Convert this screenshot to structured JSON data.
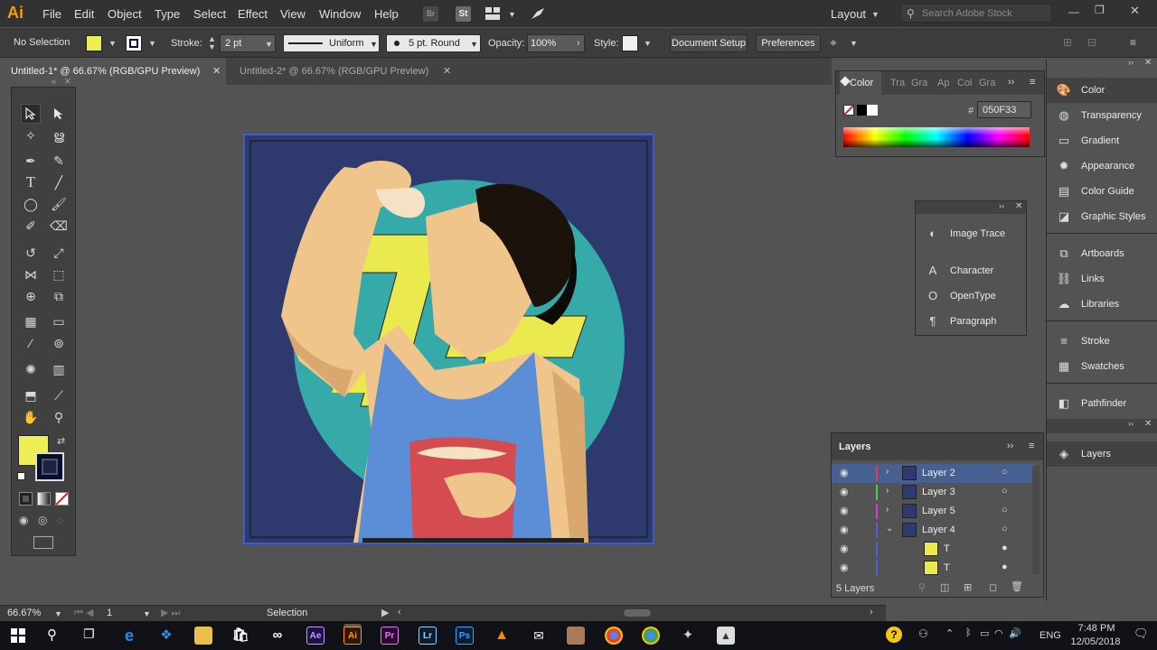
{
  "app": {
    "logo": "Ai"
  },
  "menu": [
    "File",
    "Edit",
    "Object",
    "Type",
    "Select",
    "Effect",
    "View",
    "Window",
    "Help"
  ],
  "menubar_icons": {
    "bridge": "Br",
    "stock": "St"
  },
  "workspace": {
    "label": "Layout"
  },
  "search": {
    "placeholder": "Search Adobe Stock"
  },
  "control": {
    "selection": "No Selection",
    "fill_color": "#eeee55",
    "stroke_label": "Stroke:",
    "stroke_value": "2 pt",
    "stroke_profile": "Uniform",
    "brush": "5 pt. Round",
    "opacity_label": "Opacity:",
    "opacity_value": "100%",
    "style_label": "Style:",
    "document_setup": "Document Setup",
    "preferences": "Preferences"
  },
  "tabs": [
    {
      "label": "Untitled-1* @ 66.67% (RGB/GPU Preview)",
      "active": true
    },
    {
      "label": "Untitled-2* @ 66.67% (RGB/GPU Preview)",
      "active": false
    }
  ],
  "color_panel": {
    "tabs": [
      "Color",
      "Tra",
      "Gra",
      "Ap",
      "Col",
      "Gra"
    ],
    "hash": "#",
    "hex_value": "050F33"
  },
  "float_panel": {
    "items": [
      {
        "icon": "image-trace-icon",
        "label": "Image Trace"
      },
      {
        "icon": "character-icon",
        "label": "Character"
      },
      {
        "icon": "opentype-icon",
        "label": "OpenType"
      },
      {
        "icon": "paragraph-icon",
        "label": "Paragraph"
      }
    ]
  },
  "right_dock": {
    "group1": [
      {
        "icon": "color-icon",
        "label": "Color"
      },
      {
        "icon": "transparency-icon",
        "label": "Transparency"
      },
      {
        "icon": "gradient-icon",
        "label": "Gradient"
      },
      {
        "icon": "appearance-icon",
        "label": "Appearance"
      },
      {
        "icon": "color-guide-icon",
        "label": "Color Guide"
      },
      {
        "icon": "graphic-styles-icon",
        "label": "Graphic Styles"
      }
    ],
    "group2": [
      {
        "icon": "artboards-icon",
        "label": "Artboards"
      },
      {
        "icon": "links-icon",
        "label": "Links"
      },
      {
        "icon": "libraries-icon",
        "label": "Libraries"
      }
    ],
    "group3": [
      {
        "icon": "stroke-icon",
        "label": "Stroke"
      },
      {
        "icon": "swatches-icon",
        "label": "Swatches"
      }
    ],
    "group4": [
      {
        "icon": "pathfinder-icon",
        "label": "Pathfinder"
      }
    ],
    "group5": [
      {
        "icon": "layers-icon",
        "label": "Layers"
      }
    ]
  },
  "layers_panel": {
    "title": "Layers",
    "rows": [
      {
        "name": "Layer 2",
        "color": "#e0404a",
        "expanded": false,
        "selected": true
      },
      {
        "name": "Layer 3",
        "color": "#4ecb4e",
        "expanded": false,
        "selected": false
      },
      {
        "name": "Layer 5",
        "color": "#d040d0",
        "expanded": false,
        "selected": false
      },
      {
        "name": "Layer 4",
        "color": "#5060e0",
        "expanded": true,
        "selected": false
      },
      {
        "name": "T",
        "color": "#5060e0",
        "expanded": false,
        "selected": false,
        "child": true
      },
      {
        "name": "T",
        "color": "#5060e0",
        "expanded": false,
        "selected": false,
        "child": true
      }
    ],
    "count": "5 Layers"
  },
  "status": {
    "zoom": "66.67%",
    "artboard_number": "1",
    "tool": "Selection"
  },
  "taskbar": {
    "time": "7:48 PM",
    "date": "12/05/2018",
    "lang": "ENG",
    "apps": [
      "Ae",
      "Ai",
      "Pr",
      "Lr",
      "Ps"
    ]
  }
}
